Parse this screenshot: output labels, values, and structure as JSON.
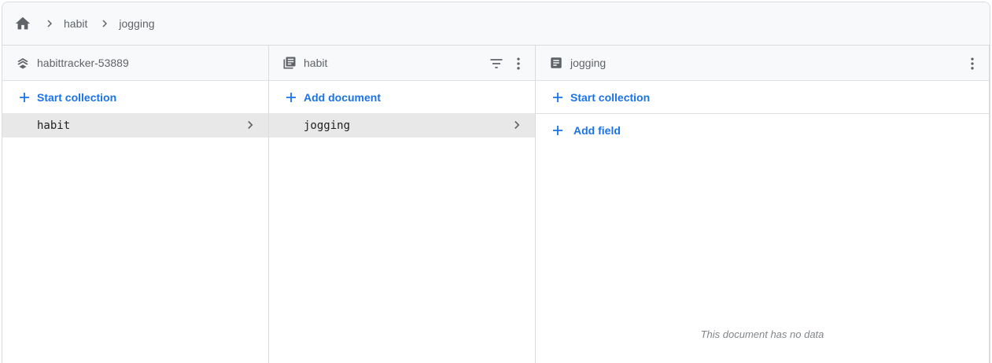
{
  "breadcrumb": {
    "home_icon": "home-icon",
    "items": [
      "habit",
      "jogging"
    ]
  },
  "columns": {
    "project": {
      "title": "habittracker-53889",
      "icon": "firestore-database-icon",
      "action_label": "Start collection",
      "items": [
        "habit"
      ]
    },
    "collection": {
      "title": "habit",
      "icon": "collection-icon",
      "action_label": "Add document",
      "items": [
        "jogging"
      ]
    },
    "document": {
      "title": "jogging",
      "icon": "document-icon",
      "start_collection_label": "Start collection",
      "add_field_label": "Add field",
      "empty_message": "This document has no data"
    }
  },
  "colors": {
    "accent": "#1a73e8",
    "selected_row": "#e8e8e8",
    "header_bg": "#f8f9fa"
  }
}
